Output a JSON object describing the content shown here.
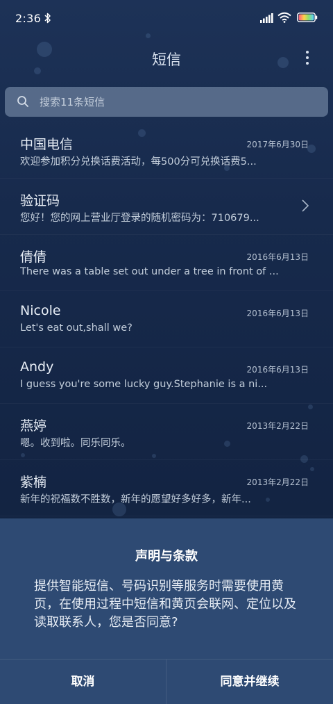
{
  "status_bar": {
    "time": "2:36",
    "icons": [
      "bluetooth-icon",
      "signal-icon",
      "wifi-icon",
      "battery-icon"
    ]
  },
  "header": {
    "title": "短信",
    "menu_icon": "more-vertical-icon"
  },
  "search": {
    "placeholder": "搜索11条短信",
    "icon": "search-icon"
  },
  "messages": [
    {
      "sender": "中国电信",
      "date": "2017年6月30日",
      "preview": "欢迎参加积分兑换话费活动，每500分可兑换话费5..."
    },
    {
      "sender": "验证码",
      "date": "",
      "preview": "您好！您的网上营业厅登录的随机密码为：710679..."
    },
    {
      "sender": "倩倩",
      "date": "2016年6月13日",
      "preview": "There was a table set out under a tree in front of ..."
    },
    {
      "sender": "Nicole",
      "date": "2016年6月13日",
      "preview": "Let's eat out,shall we?"
    },
    {
      "sender": "Andy",
      "date": "2016年6月13日",
      "preview": "I guess you're some lucky guy.Stephanie is a ni..."
    },
    {
      "sender": "燕婷",
      "date": "2013年2月22日",
      "preview": "嗯。收到啦。同乐同乐。"
    },
    {
      "sender": "紫楠",
      "date": "2013年2月22日",
      "preview": "新年的祝福数不胜数，新年的愿望好多好多，新年..."
    }
  ],
  "dialog": {
    "title": "声明与条款",
    "body": "提供智能短信、号码识别等服务时需要使用黄页，在使用过程中短信和黄页会联网、定位以及读取联系人，您是否同意?",
    "cancel_label": "取消",
    "agree_label": "同意并继续"
  },
  "colors": {
    "background": "#16284a",
    "dialog": "#2e4a73",
    "search_box": "#7d8ea5"
  }
}
